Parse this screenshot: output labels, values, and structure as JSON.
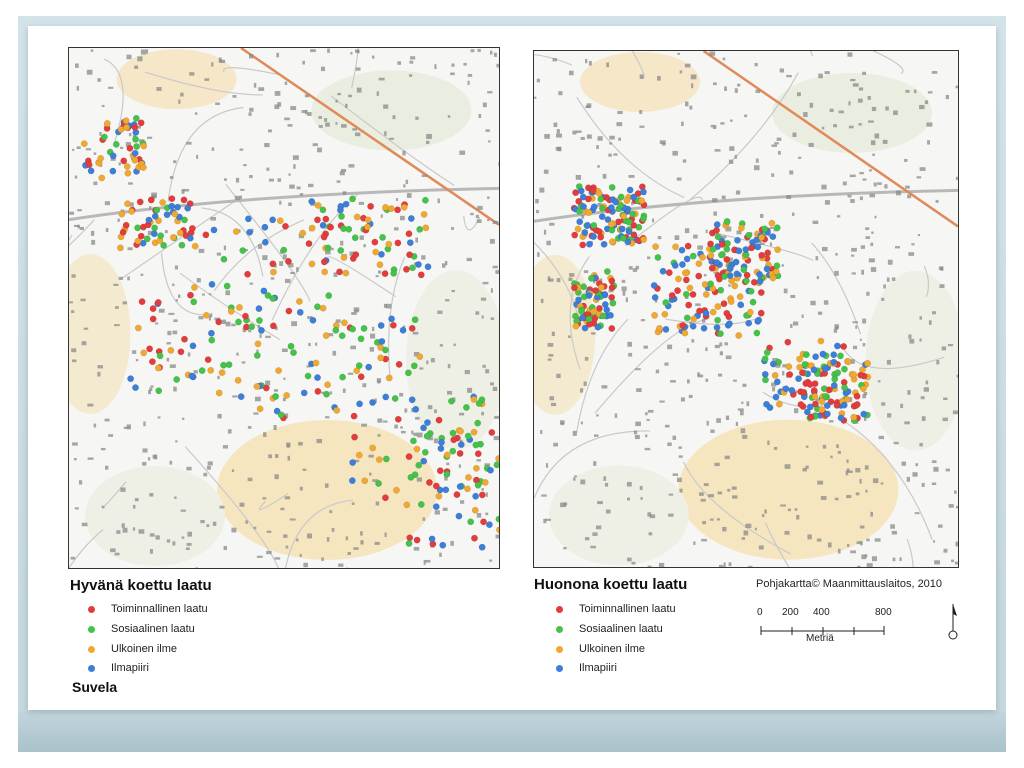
{
  "left_panel": {
    "legend_title": "Hyvänä koettu laatu",
    "area_name": "Suvela"
  },
  "right_panel": {
    "legend_title": "Huonona koettu laatu"
  },
  "legend_items": [
    {
      "label": "Toiminnallinen laatu",
      "color": "#e23c3c"
    },
    {
      "label": "Sosiaalinen laatu",
      "color": "#45c24a"
    },
    {
      "label": "Ulkoinen ilme",
      "color": "#f0a830"
    },
    {
      "label": "Ilmapiiri",
      "color": "#3c7ed8"
    }
  ],
  "credit": "Pohjakartta© Maanmittauslaitos,  2010",
  "scale": {
    "ticks": [
      "0",
      "200",
      "400",
      "800"
    ],
    "unit": "Metriä"
  }
}
